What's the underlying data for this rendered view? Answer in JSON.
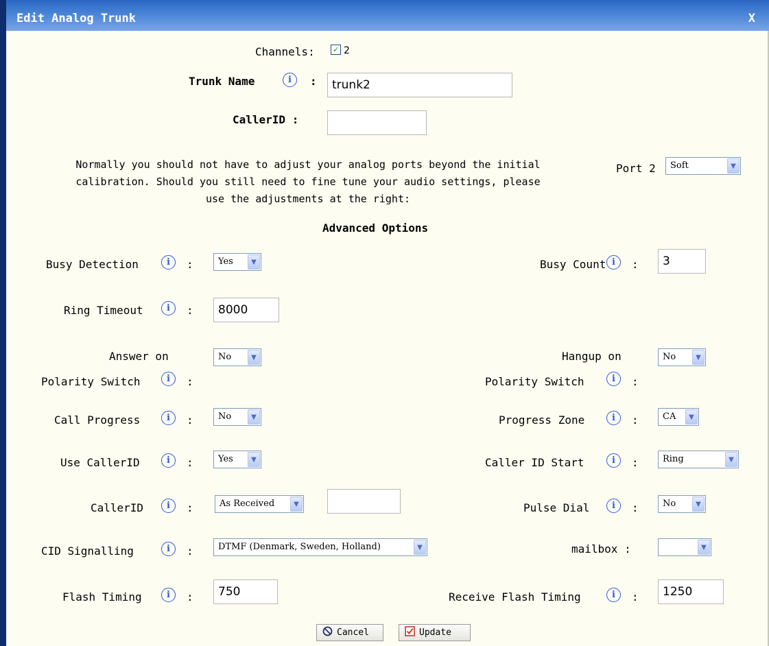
{
  "window": {
    "title": "Edit Analog Trunk",
    "close": "X"
  },
  "channels": {
    "label": "Channels:",
    "checked": true,
    "value": "2"
  },
  "trunk_name": {
    "label": "Trunk Name",
    "colon": ":",
    "value": "trunk2"
  },
  "callerid_top": {
    "label": "CallerID :",
    "value": ""
  },
  "note": {
    "line1": "Normally you should not have to adjust your analog ports beyond the initial",
    "line2": "calibration. Should you still need to fine tune your audio settings, please",
    "line3": "use the adjustments at the right:"
  },
  "port": {
    "label": "Port 2",
    "value": "Soft"
  },
  "advanced_heading": "Advanced Options",
  "fields": {
    "busy_detection": {
      "label": "Busy Detection",
      "colon": ":",
      "value": "Yes"
    },
    "busy_count": {
      "label": "Busy Count",
      "colon": ":",
      "value": "3"
    },
    "ring_timeout": {
      "label": "Ring Timeout",
      "colon": ":",
      "value": "8000"
    },
    "answer_polarity": {
      "label_line1": "Answer on",
      "label_line2": "Polarity Switch",
      "colon": ":",
      "value": "No"
    },
    "hangup_polarity": {
      "label_line1": "Hangup on",
      "label_line2": "Polarity Switch",
      "colon": ":",
      "value": "No"
    },
    "call_progress": {
      "label": "Call Progress",
      "colon": ":",
      "value": "No"
    },
    "progress_zone": {
      "label": "Progress Zone",
      "colon": ":",
      "value": "CA"
    },
    "use_callerid": {
      "label": "Use CallerID",
      "colon": ":",
      "value": "Yes"
    },
    "caller_id_start": {
      "label": "Caller ID Start",
      "colon": ":",
      "value": "Ring"
    },
    "callerid_mode": {
      "label": "CallerID",
      "colon": ":",
      "value": "As Received",
      "text_value": ""
    },
    "pulse_dial": {
      "label": "Pulse Dial",
      "colon": ":",
      "value": "No"
    },
    "cid_signalling": {
      "label": "CID Signalling",
      "colon": ":",
      "value": "DTMF (Denmark, Sweden, Holland)"
    },
    "mailbox": {
      "label": "mailbox :",
      "value": ""
    },
    "flash_timing": {
      "label": "Flash Timing",
      "colon": ":",
      "value": "750"
    },
    "receive_flash_timing": {
      "label": "Receive Flash Timing",
      "colon": ":",
      "value": "1250"
    }
  },
  "buttons": {
    "cancel": "Cancel",
    "update": "Update"
  },
  "colors": {
    "title_bar": "#3b78d3",
    "panel": "#fdfdf2",
    "info_icon": "#2e58e6",
    "left_edge": "#0e2d6e"
  },
  "icons": {
    "info": "info-icon",
    "cancel": "no-entry-icon",
    "update": "checkbox-icon"
  }
}
